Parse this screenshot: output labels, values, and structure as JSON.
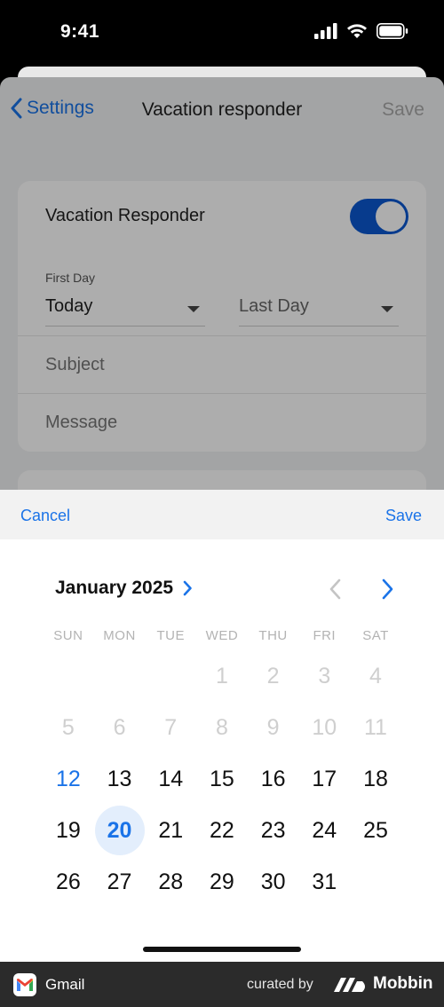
{
  "status_bar": {
    "time": "9:41"
  },
  "nav": {
    "back_label": "Settings",
    "title": "Vacation responder",
    "save_label": "Save"
  },
  "vacation": {
    "responder_label": "Vacation Responder",
    "enabled": true,
    "first_day_label": "First Day",
    "first_day_value": "Today",
    "last_day_placeholder": "Last Day",
    "subject_placeholder": "Subject",
    "message_placeholder": "Message"
  },
  "picker": {
    "cancel_label": "Cancel",
    "save_label": "Save",
    "month_title": "January 2025",
    "weekdays": [
      "SUN",
      "MON",
      "TUE",
      "WED",
      "THU",
      "FRI",
      "SAT"
    ],
    "days": [
      {
        "label": "",
        "state": "empty"
      },
      {
        "label": "",
        "state": "empty"
      },
      {
        "label": "",
        "state": "empty"
      },
      {
        "label": "1",
        "state": "disabled"
      },
      {
        "label": "2",
        "state": "disabled"
      },
      {
        "label": "3",
        "state": "disabled"
      },
      {
        "label": "4",
        "state": "disabled"
      },
      {
        "label": "5",
        "state": "disabled"
      },
      {
        "label": "6",
        "state": "disabled"
      },
      {
        "label": "7",
        "state": "disabled"
      },
      {
        "label": "8",
        "state": "disabled"
      },
      {
        "label": "9",
        "state": "disabled"
      },
      {
        "label": "10",
        "state": "disabled"
      },
      {
        "label": "11",
        "state": "disabled"
      },
      {
        "label": "12",
        "state": "today"
      },
      {
        "label": "13",
        "state": "normal"
      },
      {
        "label": "14",
        "state": "normal"
      },
      {
        "label": "15",
        "state": "normal"
      },
      {
        "label": "16",
        "state": "normal"
      },
      {
        "label": "17",
        "state": "normal"
      },
      {
        "label": "18",
        "state": "normal"
      },
      {
        "label": "19",
        "state": "normal"
      },
      {
        "label": "20",
        "state": "selected"
      },
      {
        "label": "21",
        "state": "normal"
      },
      {
        "label": "22",
        "state": "normal"
      },
      {
        "label": "23",
        "state": "normal"
      },
      {
        "label": "24",
        "state": "normal"
      },
      {
        "label": "25",
        "state": "normal"
      },
      {
        "label": "26",
        "state": "normal"
      },
      {
        "label": "27",
        "state": "normal"
      },
      {
        "label": "28",
        "state": "normal"
      },
      {
        "label": "29",
        "state": "normal"
      },
      {
        "label": "30",
        "state": "normal"
      },
      {
        "label": "31",
        "state": "normal"
      }
    ]
  },
  "footer": {
    "app_name": "Gmail",
    "curated_by": "curated by",
    "brand": "Mobbin"
  },
  "colors": {
    "accent": "#1a73e8",
    "toggle_on": "#0b57d0",
    "selected_day_bg": "#e3eefc"
  }
}
